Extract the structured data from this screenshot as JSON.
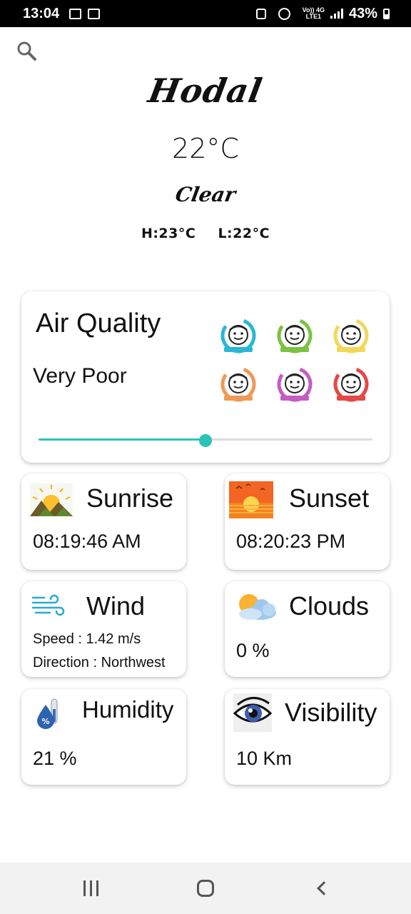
{
  "status_bar": {
    "time": "13:04",
    "network_top": "Vo)) 4G",
    "network_bottom": "LTE1",
    "battery": "43%"
  },
  "header": {
    "city": "Hodal",
    "temperature": "22°C",
    "condition": "Clear",
    "high": "H:23°C",
    "low": "L:22°C"
  },
  "air_quality": {
    "title": "Air Quality",
    "level": "Very Poor",
    "level_fraction": 0.5,
    "faces": [
      {
        "name": "good",
        "color": "#2ab7d5"
      },
      {
        "name": "satisfactory",
        "color": "#7cc242"
      },
      {
        "name": "moderate",
        "color": "#f2d85a"
      },
      {
        "name": "poor",
        "color": "#f09a58"
      },
      {
        "name": "very-poor",
        "color": "#c45cc4"
      },
      {
        "name": "severe",
        "color": "#e54848"
      }
    ],
    "accent_color": "#2bc4b4"
  },
  "sunrise": {
    "title": "Sunrise",
    "value": "08:19:46 AM"
  },
  "sunset": {
    "title": "Sunset",
    "value": "08:20:23 PM"
  },
  "wind": {
    "title": "Wind",
    "speed": "Speed : 1.42 m/s",
    "direction": "Direction : Northwest"
  },
  "clouds": {
    "title": "Clouds",
    "value": "0 %"
  },
  "humidity": {
    "title": "Humidity",
    "value": "21 %"
  },
  "visibility": {
    "title": "Visibility",
    "value": "10 Km"
  }
}
